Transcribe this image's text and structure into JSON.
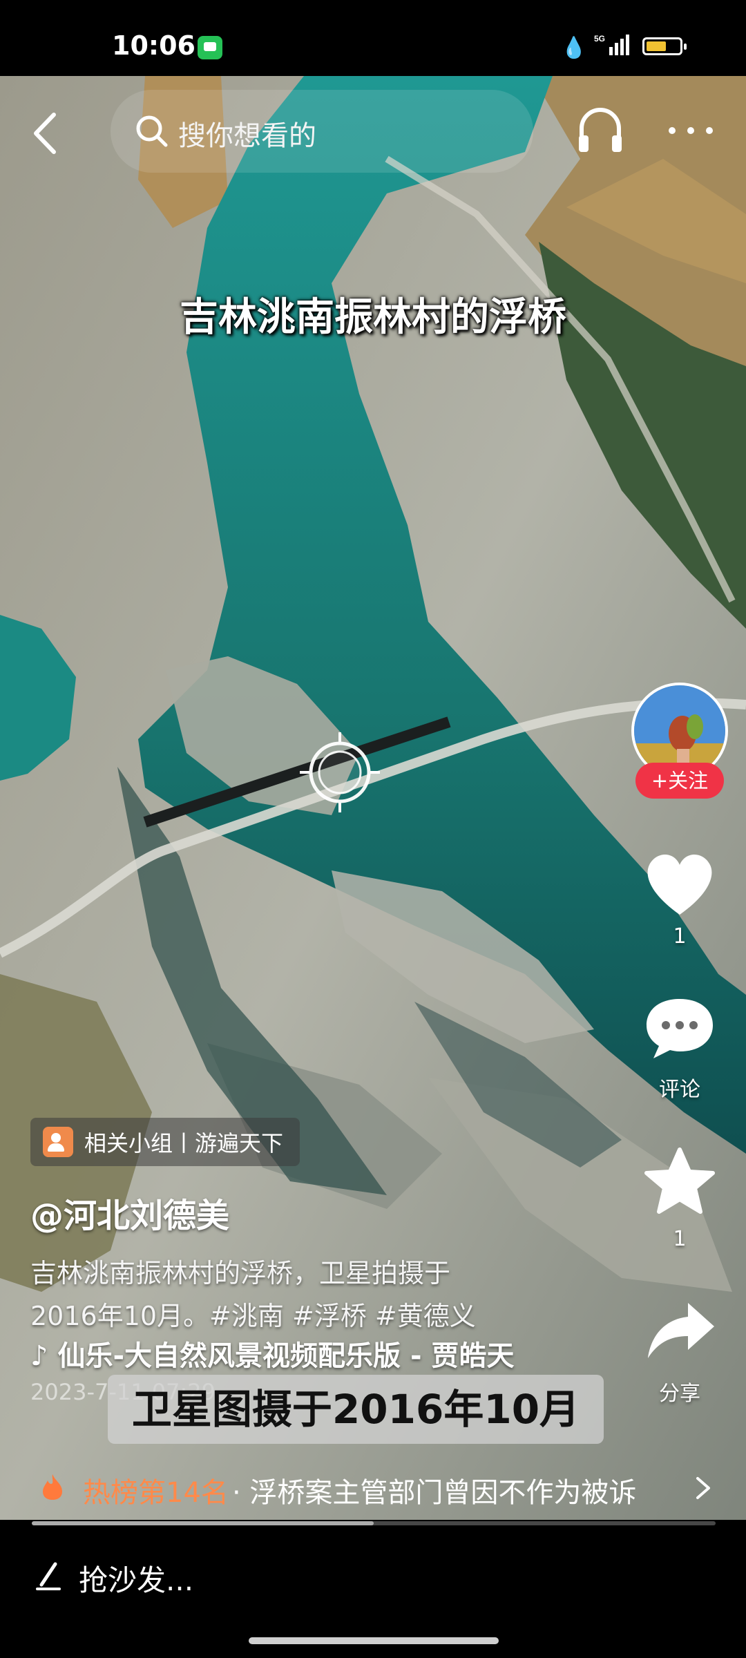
{
  "status_bar": {
    "time": "10:06",
    "network": "5G",
    "battery_level": 0.6
  },
  "search": {
    "placeholder": "搜你想看的"
  },
  "icons": {
    "back": "back-arrow-icon",
    "search": "search-icon",
    "listen": "headphones-icon",
    "more": "more-icon",
    "like": "heart-icon",
    "comment": "comment-icon",
    "favorite": "star-icon",
    "share": "share-icon",
    "hot": "fire-icon",
    "music": "music-note-icon",
    "compose": "pen-icon"
  },
  "video": {
    "caption": "吉林洮南振林村的浮桥",
    "subtitle": "卫星图摄于2016年10月"
  },
  "actions": {
    "follow_label": "+关注",
    "like_count": "1",
    "comment_label": "评论",
    "favorite_count": "1",
    "share_label": "分享"
  },
  "post": {
    "group_label": "相关小组丨游遍天下",
    "author": "@河北刘德美",
    "description_line1": "吉林洮南振林村的浮桥，卫星拍摄于",
    "description_line2": "2016年10月。#洮南 #浮桥 #黄德义",
    "music": "仙乐-大自然风景视频配乐版 - 贾皓天",
    "date": "2023-7-11 07:29"
  },
  "hot_list": {
    "rank_label": "热榜第14名",
    "title": "· 浮桥案主管部门曾因不作为被诉"
  },
  "playback": {
    "progress": 0.5
  },
  "comment_bar": {
    "placeholder": "抢沙发..."
  },
  "colors": {
    "follow_red": "#f03346",
    "hot_orange": "#ff8a4a",
    "water": "#1f8f8a"
  }
}
